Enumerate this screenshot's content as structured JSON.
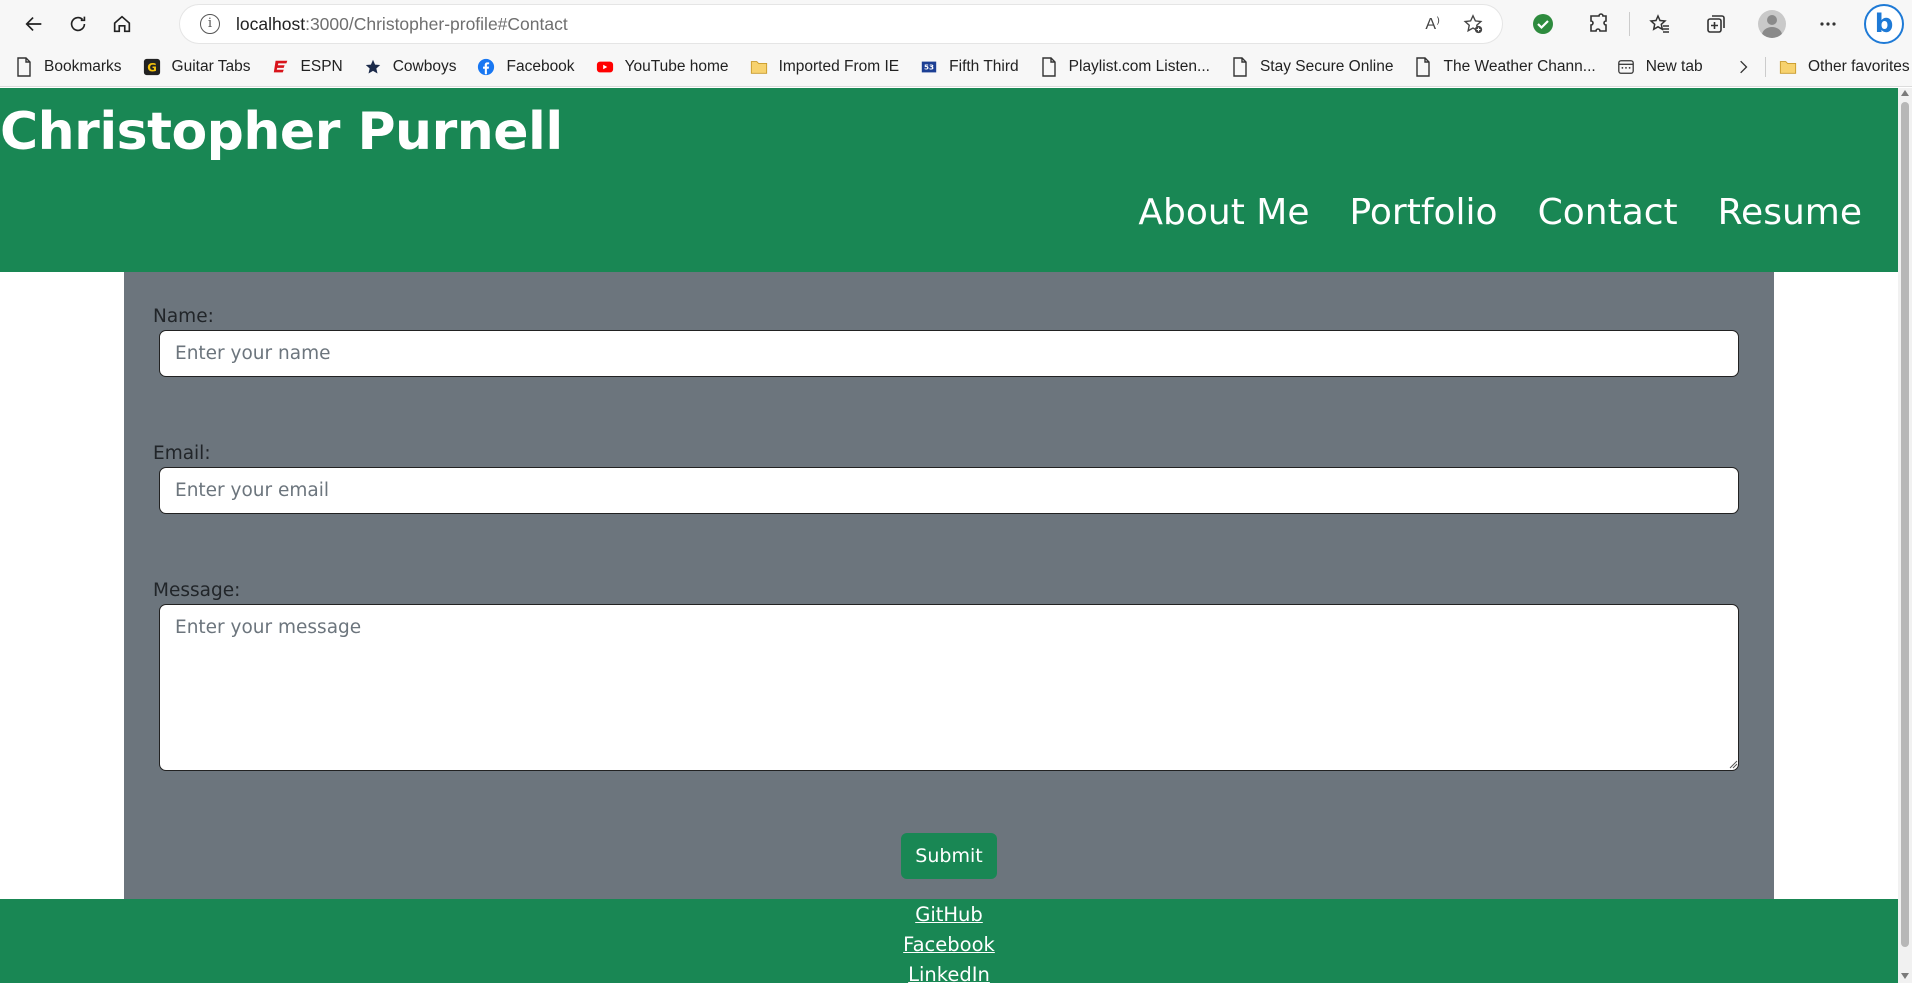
{
  "browser": {
    "url_host": "localhost",
    "url_rest": ":3000/Christopher-profile#Contact",
    "read_aloud_label": "A⁾"
  },
  "bookmarks": [
    {
      "label": "Bookmarks",
      "icon": "page-icon"
    },
    {
      "label": "Guitar Tabs",
      "icon": "guitar-tabs-icon"
    },
    {
      "label": "ESPN",
      "icon": "espn-icon"
    },
    {
      "label": "Cowboys",
      "icon": "star-icon"
    },
    {
      "label": "Facebook",
      "icon": "facebook-icon"
    },
    {
      "label": "YouTube home",
      "icon": "youtube-icon"
    },
    {
      "label": "Imported From IE",
      "icon": "folder-icon"
    },
    {
      "label": "Fifth Third",
      "icon": "fifth-third-icon"
    },
    {
      "label": "Playlist.com  Listen...",
      "icon": "page-icon"
    },
    {
      "label": "Stay Secure Online",
      "icon": "page-icon"
    },
    {
      "label": "The Weather Chann...",
      "icon": "page-icon"
    },
    {
      "label": "New tab",
      "icon": "new-tab-icon"
    }
  ],
  "other_favorites": "Other favorites",
  "site": {
    "title": "Christopher Purnell",
    "nav": [
      "About Me",
      "Portfolio",
      "Contact",
      "Resume"
    ]
  },
  "form": {
    "name_label": "Name:",
    "name_placeholder": "Enter your name",
    "email_label": "Email:",
    "email_placeholder": "Enter your email",
    "message_label": "Message:",
    "message_placeholder": "Enter your message",
    "submit_label": "Submit"
  },
  "footer": {
    "links": [
      "GitHub",
      "Facebook",
      "LinkedIn"
    ]
  },
  "colors": {
    "brand_green": "#198754",
    "panel_gray": "#6c757d"
  }
}
